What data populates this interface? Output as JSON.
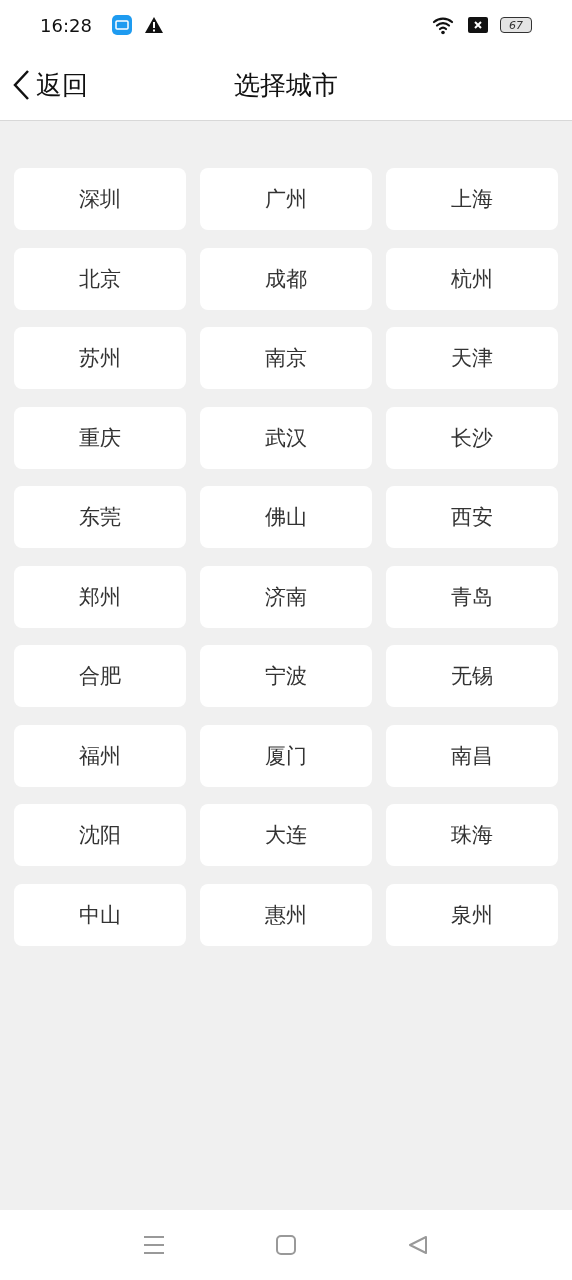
{
  "status_bar": {
    "time": "16:28",
    "battery": "67"
  },
  "header": {
    "back": "返回",
    "title": "选择城市"
  },
  "cities": [
    "深圳",
    "广州",
    "上海",
    "北京",
    "成都",
    "杭州",
    "苏州",
    "南京",
    "天津",
    "重庆",
    "武汉",
    "长沙",
    "东莞",
    "佛山",
    "西安",
    "郑州",
    "济南",
    "青岛",
    "合肥",
    "宁波",
    "无锡",
    "福州",
    "厦门",
    "南昌",
    "沈阳",
    "大连",
    "珠海",
    "中山",
    "惠州",
    "泉州"
  ]
}
